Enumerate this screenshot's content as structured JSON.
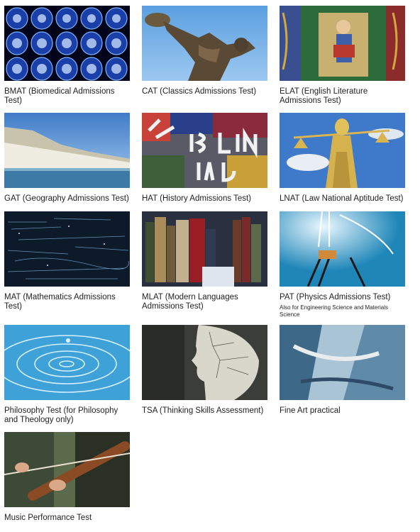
{
  "tests": [
    {
      "title": "BMAT (Biomedical Admissions Test)",
      "image": "brain-scans-image"
    },
    {
      "title": "CAT (Classics Admissions Test)",
      "image": "discus-thrower-statue-image"
    },
    {
      "title": "ELAT (English Literature Admissions Test)",
      "image": "illuminated-manuscript-image"
    },
    {
      "title": "GAT (Geography Admissions Test)",
      "image": "white-cliffs-image"
    },
    {
      "title": "HAT (History Admissions Test)",
      "image": "berlin-wall-graffiti-image"
    },
    {
      "title": "LNAT (Law National Aptitude Test)",
      "image": "lady-justice-statue-image"
    },
    {
      "title": "MAT (Mathematics Admissions Test)",
      "image": "math-formulas-image"
    },
    {
      "title": "MLAT (Modern Languages Admissions Test)",
      "image": "bookshelf-image"
    },
    {
      "title": "PAT (Physics Admissions Test)",
      "note": "Also for Engineering Science and Materials Science",
      "image": "light-bulb-filament-image"
    },
    {
      "title": "Philosophy Test (for Philosophy and Theology only)",
      "image": "water-ripple-image"
    },
    {
      "title": "TSA (Thinking Skills Assessment)",
      "image": "phrenology-head-image"
    },
    {
      "title": "Fine Art practical",
      "image": "abstract-painting-image"
    },
    {
      "title": "Music Performance Test",
      "image": "violin-player-image"
    }
  ]
}
